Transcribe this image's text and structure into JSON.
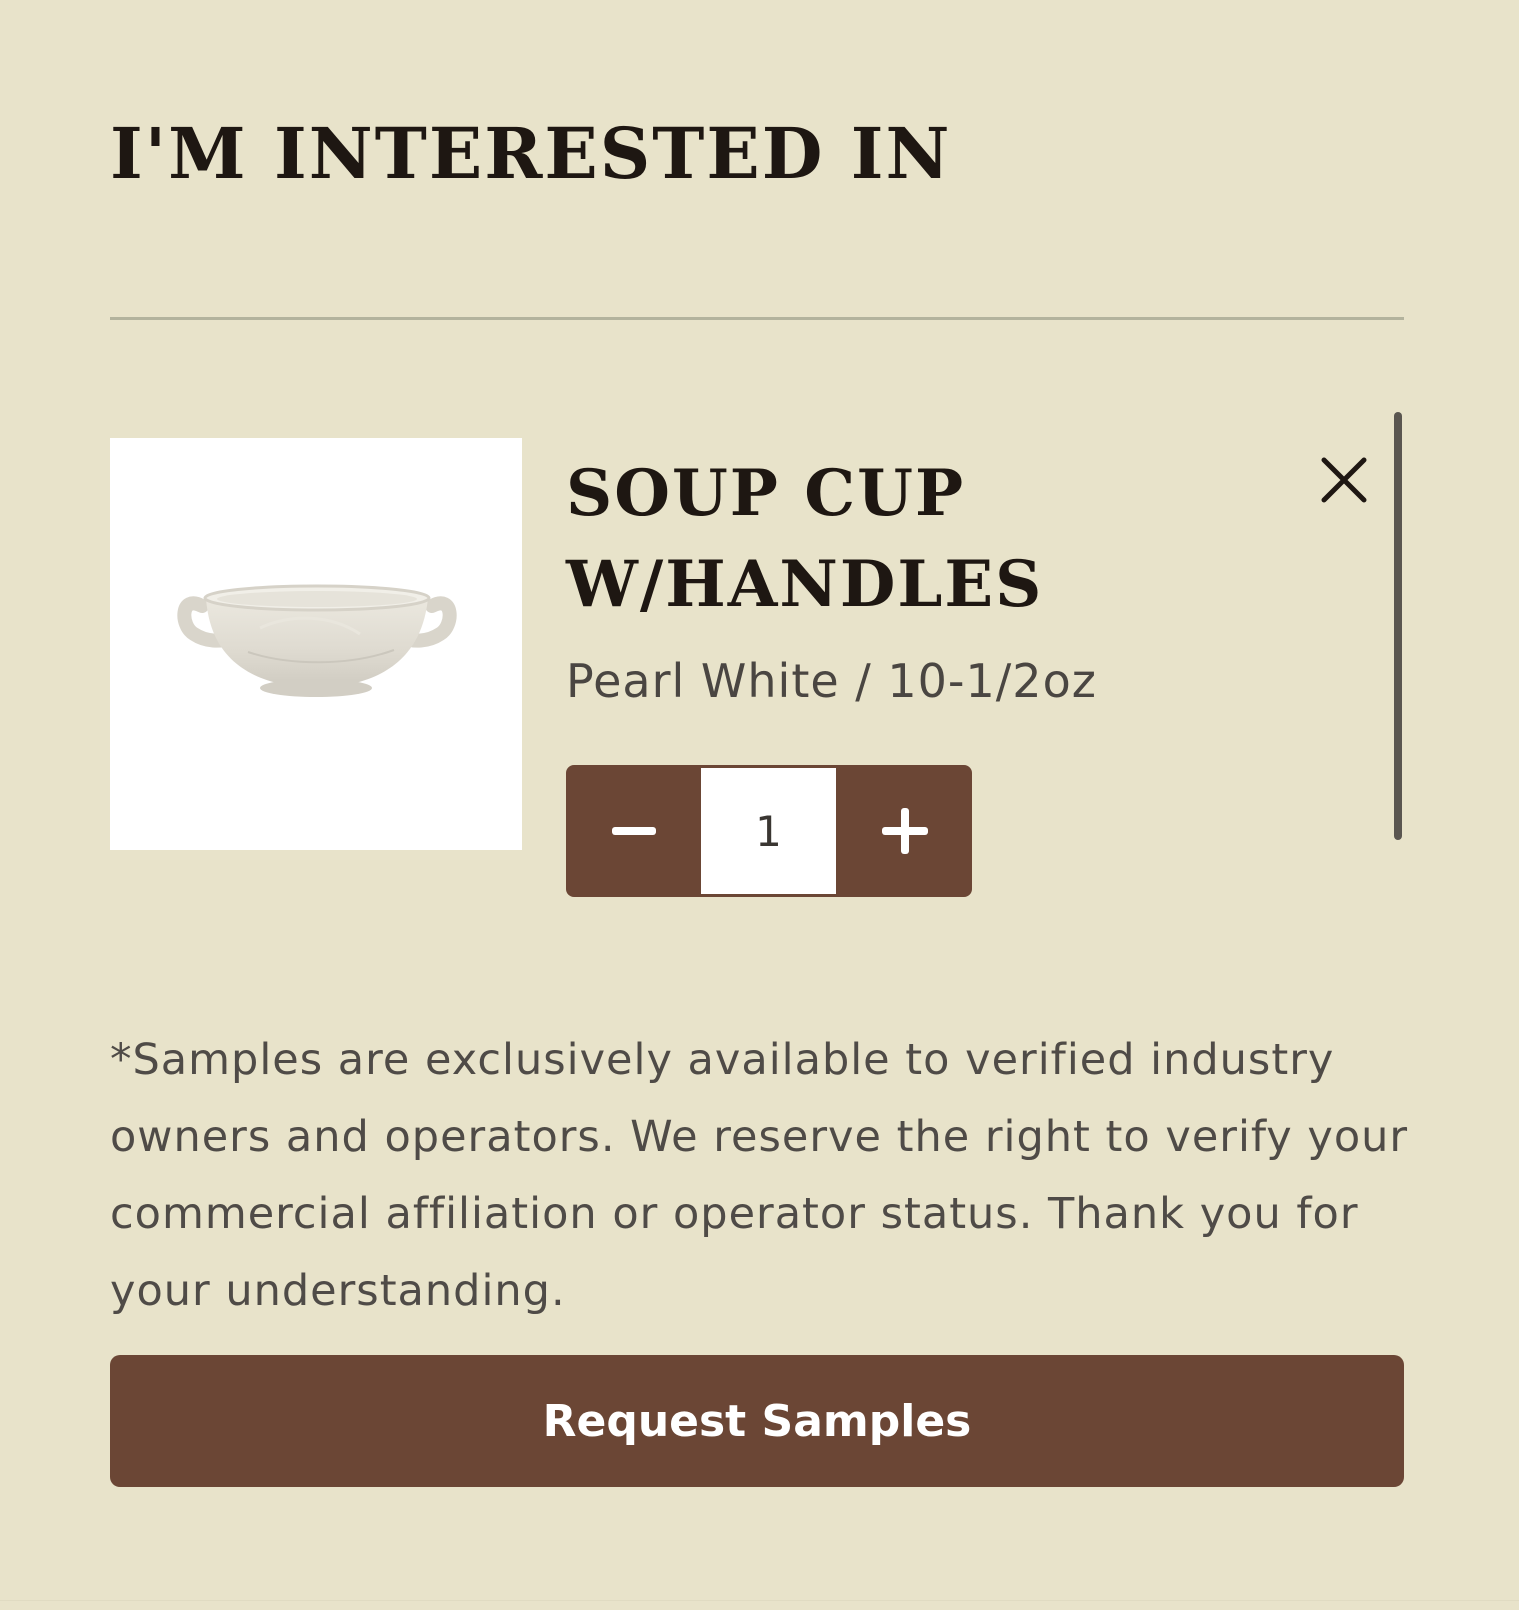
{
  "panel": {
    "heading": "I'M INTERESTED IN"
  },
  "item": {
    "title": "SOUP CUP W/HANDLES",
    "variant": "Pearl White / 10-1/2oz",
    "quantity": "1"
  },
  "note": "*Samples are exclusively available to verified industry owners and operators. We reserve the right to verify your commercial affiliation or operator status. Thank you for your understanding.",
  "actions": {
    "request_label": "Request Samples"
  },
  "colors": {
    "background": "#e8e3ca",
    "accent": "#6b4635",
    "heading_text": "#1e1712",
    "body_text": "#4f4b47"
  },
  "icons": {
    "remove": "close-icon",
    "decrease": "minus-icon",
    "increase": "plus-icon"
  }
}
